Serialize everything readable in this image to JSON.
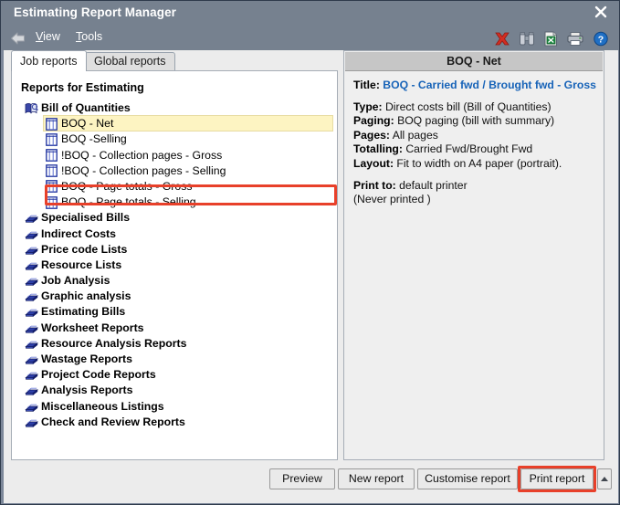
{
  "window": {
    "title": "Estimating Report Manager",
    "close_label": "✖"
  },
  "menu": {
    "back_icon": "back-arrow-icon",
    "items": [
      {
        "label": "View",
        "accel": "V"
      },
      {
        "label": "Tools",
        "accel": "T"
      }
    ],
    "toolbar_icons": [
      {
        "name": "delete-icon",
        "tip": "Delete"
      },
      {
        "name": "find-binoculars-icon",
        "tip": "Find"
      },
      {
        "name": "excel-export-icon",
        "tip": "Export to Excel"
      },
      {
        "name": "printer-icon",
        "tip": "Print"
      },
      {
        "name": "help-icon",
        "tip": "Help"
      }
    ]
  },
  "tabs": [
    {
      "label": "Job reports",
      "active": true
    },
    {
      "label": "Global reports",
      "active": false
    }
  ],
  "tree": {
    "heading": "Reports for Estimating",
    "items": [
      {
        "label": "Bill of Quantities",
        "type": "folder",
        "icon": "open-book-icon",
        "selected": false
      },
      {
        "label": "BOQ - Net",
        "type": "leaf",
        "icon": "report-grid-icon",
        "selected": true
      },
      {
        "label": "BOQ  -Selling",
        "type": "leaf",
        "icon": "report-grid-icon",
        "selected": false
      },
      {
        "label": "!BOQ - Collection pages - Gross",
        "type": "leaf",
        "icon": "report-grid-icon",
        "selected": false
      },
      {
        "label": "!BOQ - Collection pages - Selling",
        "type": "leaf",
        "icon": "report-grid-icon",
        "selected": false
      },
      {
        "label": "BOQ - Page totals - Gross",
        "type": "leaf",
        "icon": "report-grid-icon",
        "selected": false
      },
      {
        "label": "BOQ - Page totals - Selling",
        "type": "leaf",
        "icon": "report-grid-icon",
        "selected": false
      },
      {
        "label": "Specialised Bills",
        "type": "folder",
        "icon": "book-icon",
        "selected": false
      },
      {
        "label": "Indirect Costs",
        "type": "folder",
        "icon": "book-icon",
        "selected": false
      },
      {
        "label": "Price code Lists",
        "type": "folder",
        "icon": "book-icon",
        "selected": false
      },
      {
        "label": "Resource Lists",
        "type": "folder",
        "icon": "book-icon",
        "selected": false
      },
      {
        "label": "Job Analysis",
        "type": "folder",
        "icon": "book-icon",
        "selected": false
      },
      {
        "label": "Graphic analysis",
        "type": "folder",
        "icon": "book-icon",
        "selected": false
      },
      {
        "label": "Estimating Bills",
        "type": "folder",
        "icon": "book-icon",
        "selected": false
      },
      {
        "label": "Worksheet Reports",
        "type": "folder",
        "icon": "book-icon",
        "selected": false
      },
      {
        "label": "Resource Analysis Reports",
        "type": "folder",
        "icon": "book-icon",
        "selected": false
      },
      {
        "label": "Wastage Reports",
        "type": "folder",
        "icon": "book-icon",
        "selected": false
      },
      {
        "label": "Project Code Reports",
        "type": "folder",
        "icon": "book-icon",
        "selected": false
      },
      {
        "label": "Analysis Reports",
        "type": "folder",
        "icon": "book-icon",
        "selected": false
      },
      {
        "label": "Miscellaneous Listings",
        "type": "folder",
        "icon": "book-icon",
        "selected": false
      },
      {
        "label": "Check and Review Reports",
        "type": "folder",
        "icon": "book-icon",
        "selected": false
      }
    ]
  },
  "details": {
    "header": "BOQ - Net",
    "title_label": "Title:",
    "title_value": "BOQ - Carried fwd / Brought fwd - Gross",
    "type_label": "Type:",
    "type_value": "Direct costs bill (Bill of Quantities)",
    "paging_label": "Paging:",
    "paging_value": "BOQ paging (bill with summary)",
    "pages_label": "Pages:",
    "pages_value": "All pages",
    "totalling_label": "Totalling:",
    "totalling_value": "Carried Fwd/Brought Fwd",
    "layout_label": "Layout:",
    "layout_value": "Fit to width on A4 paper (portrait).",
    "printto_label": "Print to:",
    "printto_value": "default printer",
    "printed_status": "(Never printed )"
  },
  "buttons": {
    "preview": "Preview",
    "new_report": "New report",
    "customise_report": "Customise report",
    "print_report": "Print report",
    "spinner_icon": "up-arrow-icon"
  },
  "colors": {
    "titlebar": "#76818f",
    "selection_highlight": "#fdf4c2",
    "annotation_red": "#e8402a",
    "link_blue": "#1763b8",
    "panel_bg": "#efefef"
  }
}
